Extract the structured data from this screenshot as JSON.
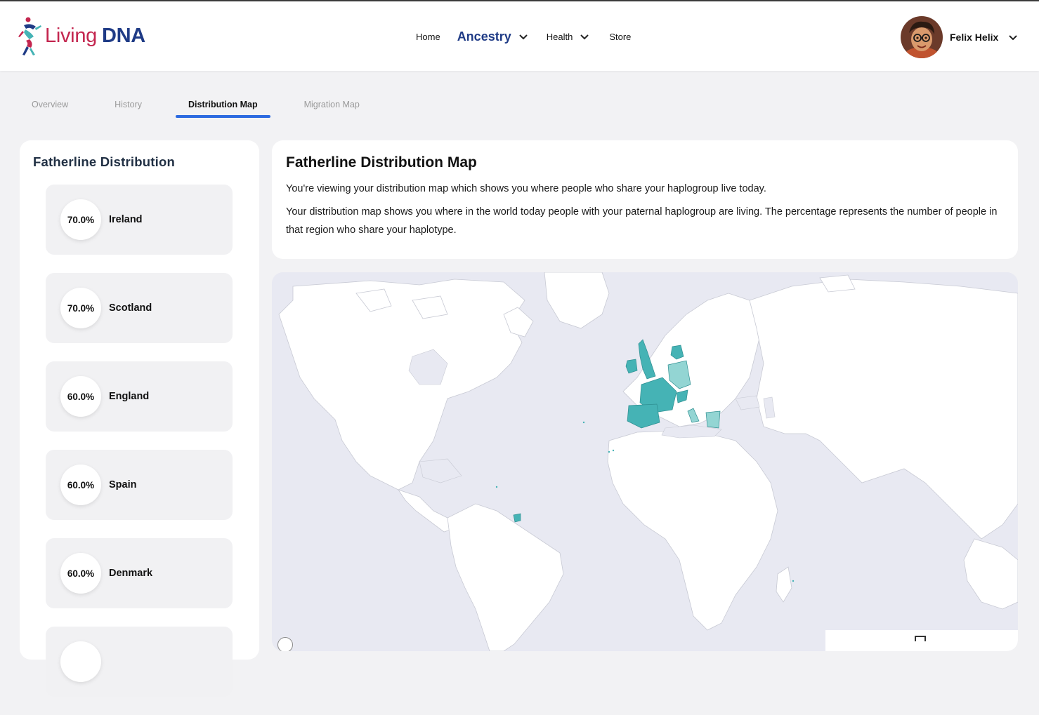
{
  "brand": {
    "living": "Living",
    "dna": "DNA"
  },
  "nav": {
    "home": "Home",
    "ancestry": "Ancestry",
    "health": "Health",
    "store": "Store"
  },
  "user": {
    "name": "Felix Helix"
  },
  "tabs": [
    {
      "label": "Overview"
    },
    {
      "label": "History"
    },
    {
      "label": "Distribution Map"
    },
    {
      "label": "Migration Map"
    }
  ],
  "active_tab": "Distribution Map",
  "sidebar": {
    "title": "Fatherline Distribution",
    "regions": [
      {
        "pct": "70.0%",
        "name": "Ireland"
      },
      {
        "pct": "70.0%",
        "name": "Scotland"
      },
      {
        "pct": "60.0%",
        "name": "England"
      },
      {
        "pct": "60.0%",
        "name": "Spain"
      },
      {
        "pct": "60.0%",
        "name": "Denmark"
      },
      {
        "pct": "",
        "name": ""
      }
    ]
  },
  "info": {
    "title": "Fatherline Distribution Map",
    "line1": "You're viewing your distribution map which shows you where people who share your haplogroup live today.",
    "line2": "Your distribution map shows you where in the world today people with your paternal haplogroup are living. The percentage represents the number of people in that region who share your haplotype."
  },
  "map": {
    "ocean_color": "#e8e9f2",
    "land_color": "#ffffff",
    "border_color": "#c8cad4",
    "highlight_strong": "#45b3b5",
    "highlight_light": "#93d5d3"
  }
}
